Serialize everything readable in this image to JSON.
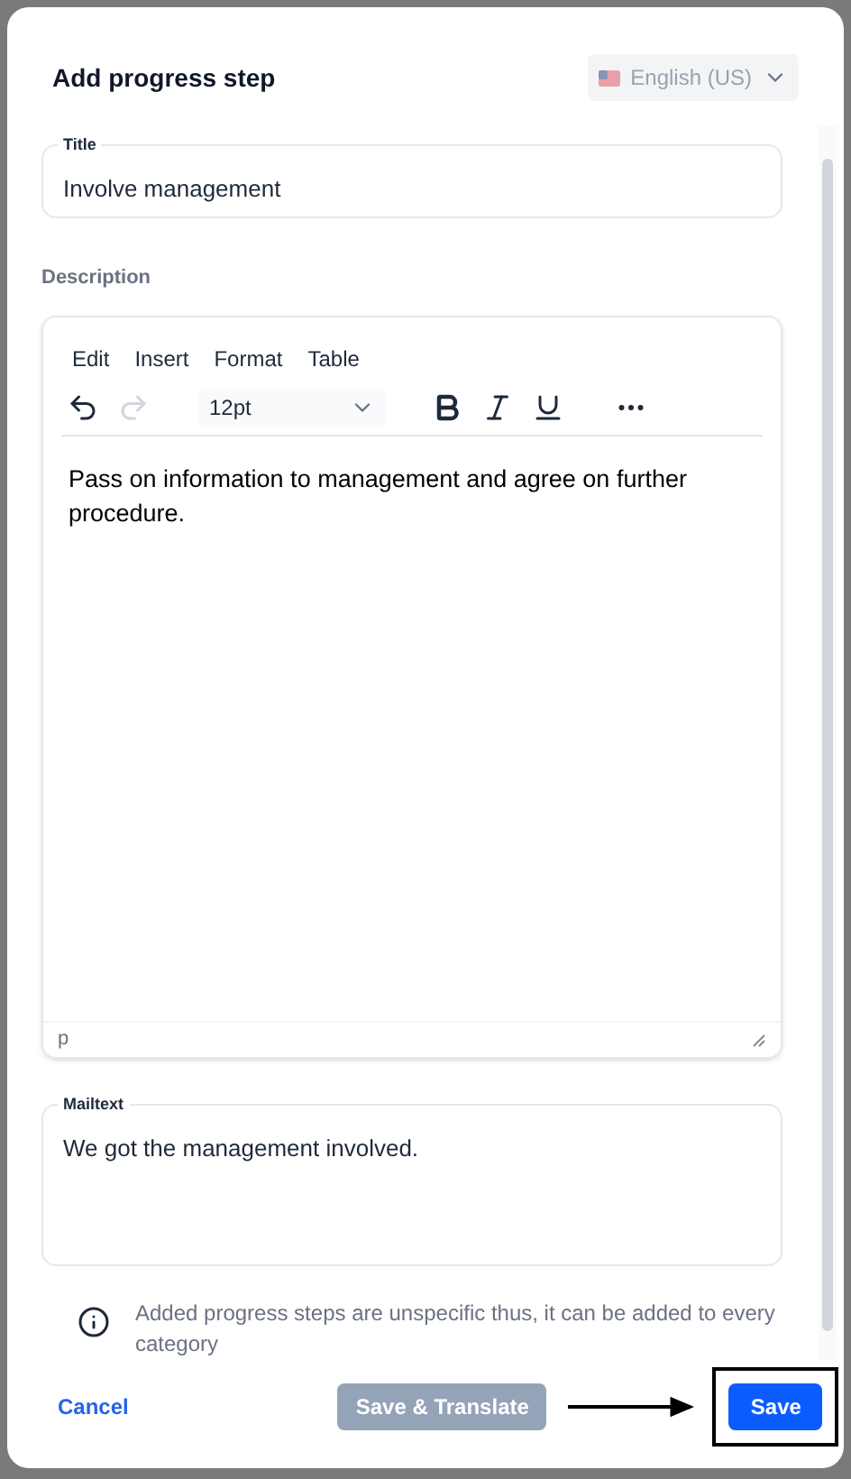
{
  "header": {
    "title": "Add progress step",
    "language": "English (US)"
  },
  "title_field": {
    "label": "Title",
    "value": "Involve management"
  },
  "description": {
    "label": "Description",
    "menu": [
      "Edit",
      "Insert",
      "Format",
      "Table"
    ],
    "font_size": "12pt",
    "toolbar": [
      {
        "kind": "undo",
        "disabled": false
      },
      {
        "kind": "redo",
        "disabled": true
      },
      {
        "kind": "bold",
        "disabled": false
      },
      {
        "kind": "italic",
        "disabled": false
      },
      {
        "kind": "underline",
        "disabled": false
      },
      {
        "kind": "more",
        "disabled": false
      }
    ],
    "content": "Pass on information to management and agree on further procedure.",
    "status_path": "p"
  },
  "mailtext_field": {
    "label": "Mailtext",
    "value": "We got the management involved."
  },
  "info_note": "Added progress steps are unspecific thus, it can be added to every category",
  "footer": {
    "cancel": "Cancel",
    "save_translate": {
      "label": "Save & Translate",
      "disabled": true
    },
    "save": {
      "label": "Save",
      "highlighted": true
    }
  }
}
